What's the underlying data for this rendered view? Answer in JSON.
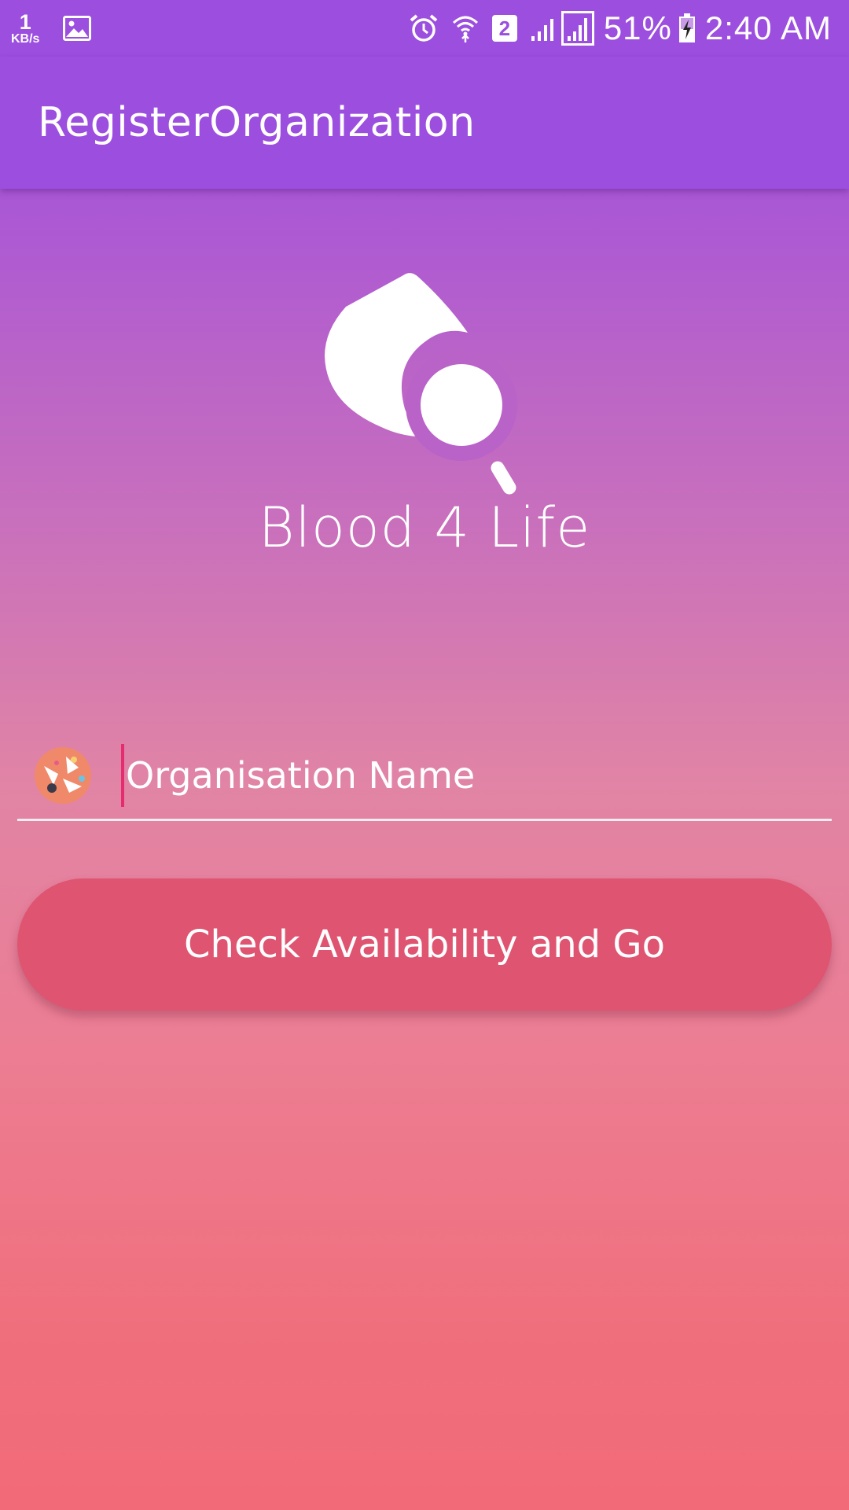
{
  "status_bar": {
    "net_speed_value": "1",
    "net_speed_unit": "KB/s",
    "sim_slot": "2",
    "battery_percent": "51%",
    "time": "2:40 AM",
    "icons": [
      "gallery-icon",
      "alarm-icon",
      "wifi-icon",
      "signal-icon",
      "signal-icon",
      "battery-charging-icon"
    ]
  },
  "app_bar": {
    "title": "RegisterOrganization"
  },
  "logo": {
    "brand_name": "Blood 4 Life",
    "icon": "blood-drop-magnifier-icon"
  },
  "form": {
    "org_name_placeholder": "Organisation Name",
    "org_name_value": "",
    "org_icon": "organisation-icon",
    "submit_label": "Check Availability and Go"
  },
  "colors": {
    "primary": "#9c4edf",
    "button": "#df5470",
    "cursor": "#e62c6e",
    "gradient_top": "#9f4fdf",
    "gradient_bottom": "#f26a78"
  }
}
